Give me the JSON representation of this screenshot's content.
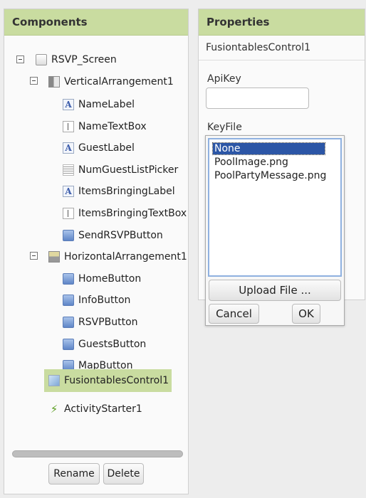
{
  "components": {
    "header": "Components",
    "tree": [
      {
        "label": "RSVP_Screen",
        "icon": "screen-icon"
      },
      {
        "label": "VerticalArrangement1",
        "icon": "vertical-arrangement-icon"
      },
      {
        "label": "NameLabel",
        "icon": "label-icon"
      },
      {
        "label": "NameTextBox",
        "icon": "textbox-icon"
      },
      {
        "label": "GuestLabel",
        "icon": "label-icon"
      },
      {
        "label": "NumGuestListPicker",
        "icon": "listpicker-icon"
      },
      {
        "label": "ItemsBringingLabel",
        "icon": "label-icon"
      },
      {
        "label": "ItemsBringingTextBox",
        "icon": "textbox-icon"
      },
      {
        "label": "SendRSVPButton",
        "icon": "button-icon"
      },
      {
        "label": "HorizontalArrangement1",
        "icon": "horizontal-arrangement-icon"
      },
      {
        "label": "HomeButton",
        "icon": "button-icon"
      },
      {
        "label": "InfoButton",
        "icon": "button-icon"
      },
      {
        "label": "RSVPButton",
        "icon": "button-icon"
      },
      {
        "label": "GuestsButton",
        "icon": "button-icon"
      },
      {
        "label": "MapButton",
        "icon": "button-icon"
      },
      {
        "label": "FusiontablesControl1",
        "icon": "fusiontables-icon",
        "selected": true
      },
      {
        "label": "ActivityStarter1",
        "icon": "activity-starter-icon"
      }
    ],
    "rename_label": "Rename",
    "delete_label": "Delete"
  },
  "properties": {
    "header": "Properties",
    "component_name": "FusiontablesControl1",
    "apikey_label": "ApiKey",
    "apikey_value": "",
    "keyfile_label": "KeyFile",
    "keyfile_options": [
      "None",
      "PoolImage.png",
      "PoolPartyMessage.png"
    ],
    "keyfile_selected": "None",
    "upload_label": "Upload File ...",
    "cancel_label": "Cancel",
    "ok_label": "OK"
  },
  "colors": {
    "header_bg": "#c9dca0",
    "selected_bg": "#c9dca0",
    "option_selected_bg": "#2c56a6"
  }
}
